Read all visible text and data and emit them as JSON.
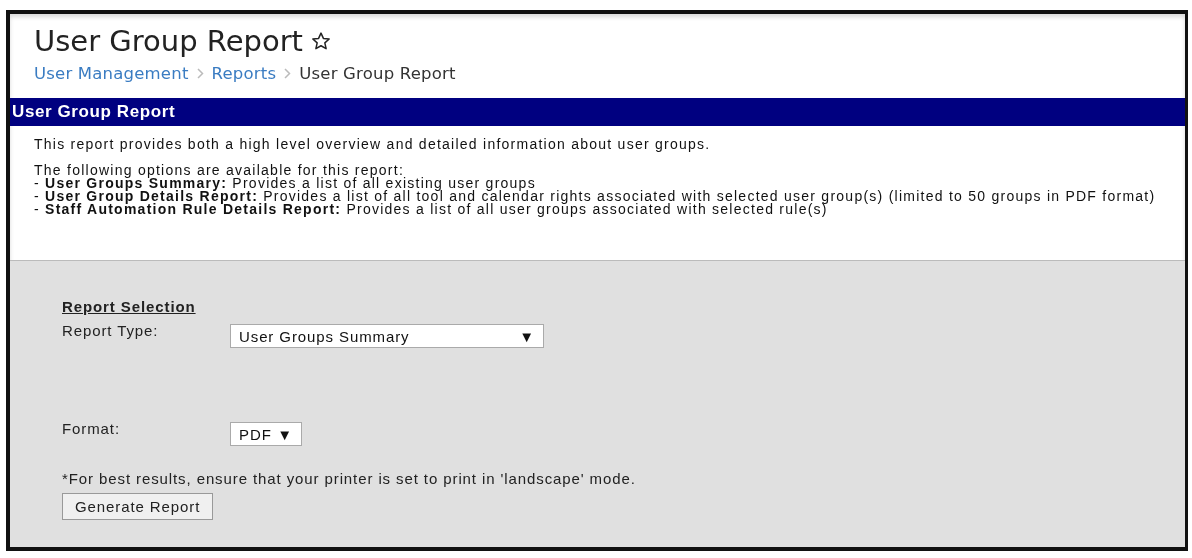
{
  "page": {
    "title": "User Group Report"
  },
  "breadcrumb": [
    {
      "label": "User Management",
      "link": true
    },
    {
      "label": "Reports",
      "link": true
    },
    {
      "label": "User Group Report",
      "link": false
    }
  ],
  "section_header": "User Group Report",
  "description": {
    "intro": "This report provides both a high level overview and detailed information about user groups.",
    "options_heading": "The following options are available for this report:",
    "options": [
      "- **User Groups Summary:** Provides a list of all existing user groups",
      "- **User Group Details Report:** Provides a list of all tool and calendar rights associated with selected user group(s) (limited to 50 groups in PDF format)",
      "- **Staff Automation Rule Details Report:** Provides a list of all user groups associated with selected rule(s)"
    ]
  },
  "form": {
    "heading": "Report Selection",
    "report_type": {
      "label": "Report Type:",
      "value": "User Groups Summary",
      "arrow": "▼"
    },
    "format": {
      "label": "Format:",
      "value": "PDF",
      "arrow": "▼"
    },
    "note": "*For best results, ensure that your printer is set to print in 'landscape' mode.",
    "button": "Generate Report"
  }
}
